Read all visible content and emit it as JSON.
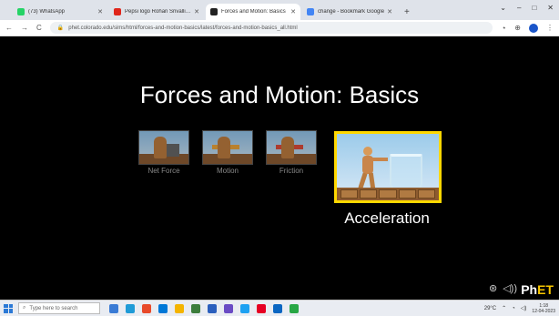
{
  "browser": {
    "tabs": [
      {
        "title": "(73) WhatsApp",
        "color": "#25d366",
        "active": false
      },
      {
        "title": "Pepsi logo Rohan Srivalli Ch",
        "color": "#e0261b",
        "active": false
      },
      {
        "title": "Forces and Motion: Basics",
        "color": "#222222",
        "active": true
      },
      {
        "title": "change - Bookmark Google",
        "color": "#4285f4",
        "active": false
      }
    ],
    "new_tab": "+",
    "window_controls": [
      "⌄",
      "–",
      "□",
      "✕"
    ],
    "nav": [
      "←",
      "→",
      "C"
    ],
    "url": "phet.colorado.edu/sims/html/forces-and-motion-basics/latest/forces-and-motion-basics_all.html",
    "tools": [
      "⋆",
      "⊕"
    ]
  },
  "sim": {
    "title": "Forces and Motion: Basics",
    "screens": [
      {
        "label": "Net Force"
      },
      {
        "label": "Motion"
      },
      {
        "label": "Friction"
      }
    ],
    "selected_label": "Acceleration",
    "controls": [
      "⊛",
      "◁))"
    ],
    "phet_logo": {
      "ph": "Ph",
      "et": "ET"
    }
  },
  "taskbar": {
    "search_placeholder": "Type here to search",
    "apps": [
      "#3a7bd5",
      "#1f9bd7",
      "#e84a2a",
      "#0078d7",
      "#f4b400",
      "#3c7d3c",
      "#2b5fbd",
      "#6a4bc4",
      "#1da1f2",
      "#e60023",
      "#0a66c2",
      "#28a745"
    ],
    "weather": "29°C",
    "time": "1:18",
    "date": "12-04-2023"
  },
  "colors": {
    "selection_border": "#ffd800",
    "phet_accent": "#f7c600"
  }
}
